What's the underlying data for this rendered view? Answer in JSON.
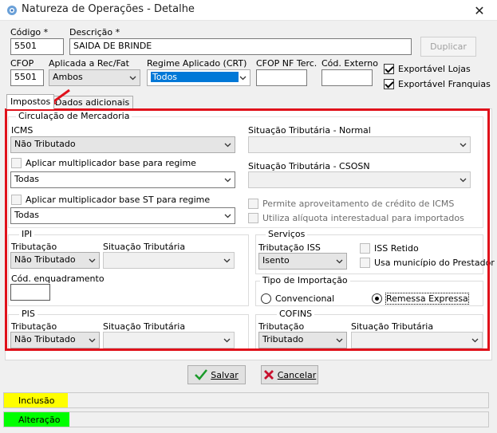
{
  "window": {
    "title": "Natureza de Operações - Detalhe",
    "close": "✕"
  },
  "header": {
    "codigo_label": "Código *",
    "codigo_value": "5501",
    "descricao_label": "Descrição *",
    "descricao_value": "SAIDA DE BRINDE",
    "duplicar_label": "Duplicar",
    "cfop_label": "CFOP",
    "cfop_value": "5501",
    "aplicada_label": "Aplicada a Rec/Fat",
    "aplicada_value": "Ambos",
    "regime_label": "Regime Aplicado (CRT)",
    "regime_value": "Todos",
    "cfop_nf_label": "CFOP NF Terc.",
    "cfop_nf_value": "",
    "cod_externo_label": "Cód. Externo",
    "cod_externo_value": "",
    "exportavel_lojas_label": "Exportável Lojas",
    "exportavel_franquias_label": "Exportável Franquias"
  },
  "tabs": [
    {
      "label": "Impostos"
    },
    {
      "label": "Dados adicionais"
    }
  ],
  "circulacao": {
    "group_label": "Circulação de Mercadoria",
    "icms_label": "ICMS",
    "icms_value": "Não Tributado",
    "sit_normal_label": "Situação Tributária - Normal",
    "sit_normal_value": "",
    "mult_base_label": "Aplicar multiplicador base para regime",
    "mult_base_value": "Todas",
    "sit_csosn_label": "Situação Tributária - CSOSN",
    "sit_csosn_value": "",
    "mult_st_label": "Aplicar multiplicador base ST para regime",
    "mult_st_value": "Todas",
    "credito_label": "Permite aproveitamento de crédito de ICMS",
    "aliquota_label": "Utiliza alíquota interestadual para importados"
  },
  "ipi": {
    "group_label": "IPI",
    "tributacao_label": "Tributação",
    "tributacao_value": "Não Tributado",
    "situacao_label": "Situação Tributária",
    "situacao_value": "",
    "enquadramento_label": "Cód. enquadramento",
    "enquadramento_value": ""
  },
  "servicos": {
    "group_label": "Serviços",
    "trib_iss_label": "Tributação ISS",
    "trib_iss_value": "Isento",
    "iss_retido_label": "ISS Retido",
    "usa_municipio_label": "Usa município do Prestador"
  },
  "importacao": {
    "group_label": "Tipo de Importação",
    "convencional_label": "Convencional",
    "remessa_label": "Remessa Expressa"
  },
  "pis": {
    "group_label": "PIS",
    "tributacao_label": "Tributação",
    "tributacao_value": "Não Tributado",
    "situacao_label": "Situação Tributária",
    "situacao_value": ""
  },
  "cofins": {
    "group_label": "COFINS",
    "tributacao_label": "Tributação",
    "tributacao_value": "Tributado",
    "situacao_label": "Situação Tributária",
    "situacao_value": ""
  },
  "footer": {
    "salvar_label": "Salvar",
    "cancelar_label": "Cancelar"
  },
  "status": {
    "inclusao": "Inclusão",
    "alteracao": "Alteração",
    "inclusao_color": "#ffff00",
    "alteracao_color": "#00ff00"
  },
  "annotation": {
    "highlight_color": "#e0111b"
  }
}
